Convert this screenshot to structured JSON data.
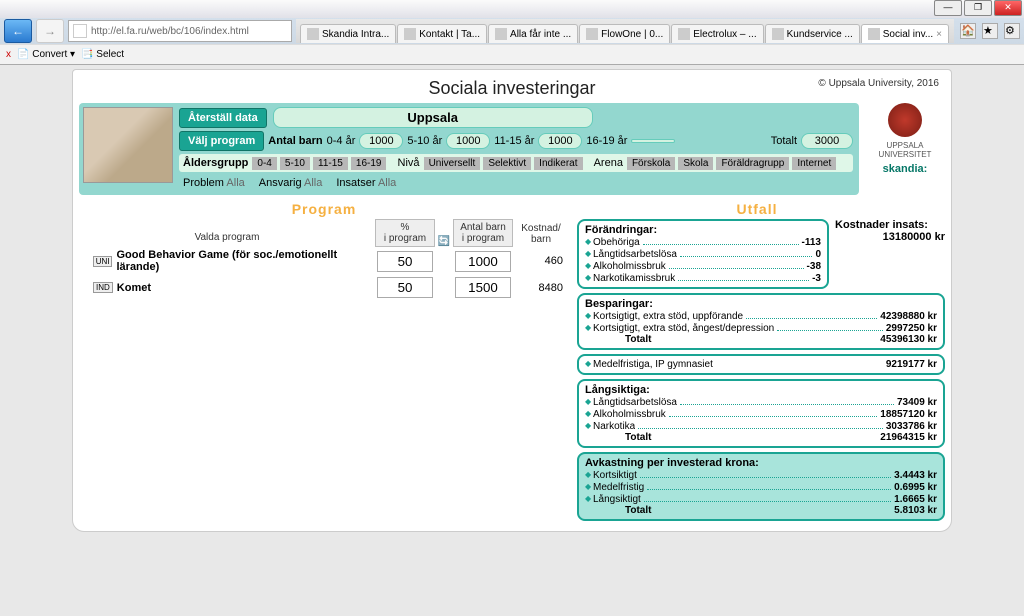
{
  "browser": {
    "url": "http://el.fa.ru/web/bc/106/index.html",
    "tabs": [
      {
        "label": "Skandia Intra..."
      },
      {
        "label": "Kontakt | Ta..."
      },
      {
        "label": "Alla får inte ..."
      },
      {
        "label": "FlowOne | 0..."
      },
      {
        "label": "Electrolux – ..."
      },
      {
        "label": "Kundservice ..."
      },
      {
        "label": "Social inv..."
      }
    ],
    "toolbar2_close": "x",
    "toolbar2_convert": "Convert",
    "toolbar2_select": "Select"
  },
  "app": {
    "title": "Sociala investeringar",
    "copyright": "© Uppsala University, 2016",
    "btn_restore": "Återställ data",
    "btn_choose": "Välj program",
    "municipality": "Uppsala",
    "antal_barn_label": "Antal barn",
    "age_groups": [
      {
        "label": "0-4 år",
        "value": "1000"
      },
      {
        "label": "5-10 år",
        "value": "1000"
      },
      {
        "label": "11-15 år",
        "value": "1000"
      },
      {
        "label": "16-19 år",
        "value": ""
      }
    ],
    "totalt_label": "Totalt",
    "totalt_value": "3000",
    "filters": {
      "aldersgrupp_label": "Åldersgrupp",
      "ages": [
        "0-4",
        "5-10",
        "11-15",
        "16-19"
      ],
      "niva_label": "Nivå",
      "niva": [
        "Universellt",
        "Selektivt",
        "Indikerat"
      ],
      "arena_label": "Arena",
      "arena": [
        "Förskola",
        "Skola",
        "Föräldragrupp",
        "Internet"
      ],
      "problem_label": "Problem",
      "problem_value": "Alla",
      "ansvarig_label": "Ansvarig",
      "ansvarig_value": "Alla",
      "insatser_label": "Insatser",
      "insatser_value": "Alla"
    },
    "uu_label": "UPPSALA UNIVERSITET",
    "skandia": "skandia:"
  },
  "sections": {
    "program": "Program",
    "utfall": "Utfall"
  },
  "programs": {
    "head_name": "Valda program",
    "head_pct_1": "%",
    "head_pct_2": "i program",
    "head_antal_1": "Antal barn",
    "head_antal_2": "i program",
    "head_kost_1": "Kostnad/",
    "head_kost_2": "barn",
    "rows": [
      {
        "tag": "UNI",
        "name": "Good Behavior Game (för soc./emotionellt lärande)",
        "pct": "50",
        "antal": "1000",
        "kost": "460"
      },
      {
        "tag": "IND",
        "name": "Komet",
        "pct": "50",
        "antal": "1500",
        "kost": "8480"
      }
    ]
  },
  "utfall": {
    "kostnader_label": "Kostnader insats:",
    "kostnader_value": "13180000 kr",
    "forandringar": {
      "title": "Förändringar:",
      "items": [
        {
          "label": "Obehöriga",
          "val": "-113"
        },
        {
          "label": "Långtidsarbetslösa",
          "val": "0"
        },
        {
          "label": "Alkoholmissbruk",
          "val": "-38"
        },
        {
          "label": "Narkotikamissbruk",
          "val": "-3"
        }
      ]
    },
    "besparingar": {
      "title": "Besparingar:",
      "items": [
        {
          "label": "Kortsigtigt, extra stöd, uppförande",
          "val": "42398880 kr"
        },
        {
          "label": "Kortsigtigt, extra stöd, ångest/depression",
          "val": "2997250 kr"
        }
      ],
      "totalt_label": "Totalt",
      "totalt_val": "45396130 kr"
    },
    "medel": {
      "label": "Medelfristiga, IP gymnasiet",
      "val": "9219177 kr"
    },
    "lang": {
      "title": "Långsiktiga:",
      "items": [
        {
          "label": "Långtidsarbetslösa",
          "val": "73409 kr"
        },
        {
          "label": "Alkoholmissbruk",
          "val": "18857120 kr"
        },
        {
          "label": "Narkotika",
          "val": "3033786 kr"
        }
      ],
      "totalt_label": "Totalt",
      "totalt_val": "21964315 kr"
    },
    "roi": {
      "title": "Avkastning per investerad krona:",
      "items": [
        {
          "label": "Kortsiktigt",
          "val": "3.4443 kr"
        },
        {
          "label": "Medelfristig",
          "val": "0.6995 kr"
        },
        {
          "label": "Långsiktigt",
          "val": "1.6665 kr"
        }
      ],
      "totalt_label": "Totalt",
      "totalt_val": "5.8103 kr"
    }
  }
}
